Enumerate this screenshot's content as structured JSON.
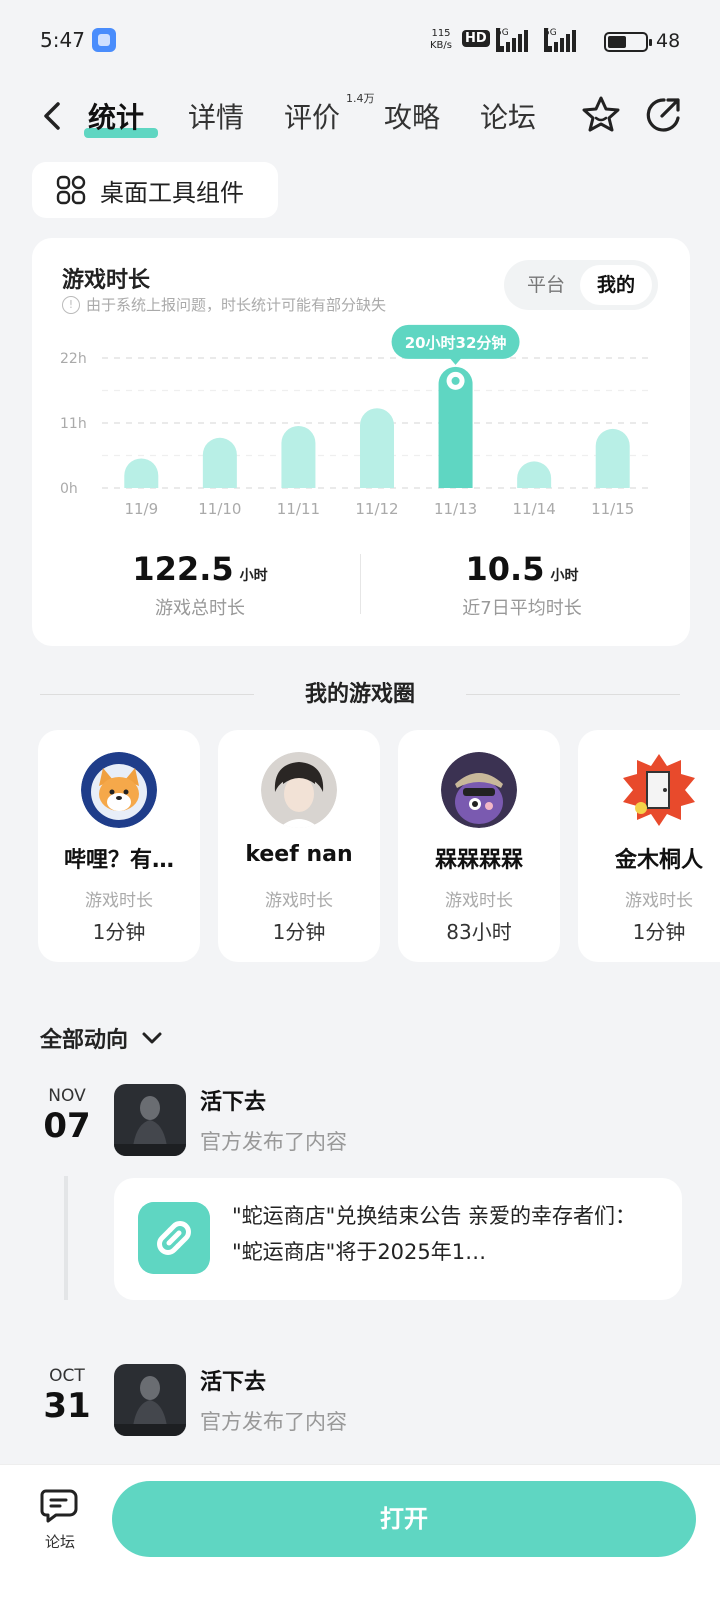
{
  "status_bar": {
    "time": "5:47",
    "net_speed": "115",
    "net_unit": "KB/s",
    "hd": "HD",
    "sim1": "5G",
    "sim2": "5G",
    "battery": "48"
  },
  "nav": {
    "tabs": [
      {
        "label": "统计",
        "active": true
      },
      {
        "label": "详情"
      },
      {
        "label": "评价",
        "badge": "1.4万"
      },
      {
        "label": "攻略"
      },
      {
        "label": "论坛"
      }
    ]
  },
  "widget_chip": {
    "label": "桌面工具组件"
  },
  "playtime_card": {
    "title": "游戏时长",
    "note": "由于系统上报问题，时长统计可能有部分缺失",
    "segment": {
      "options": [
        "平台",
        "我的"
      ],
      "selected": "我的"
    },
    "tooltip": "20小时32分钟",
    "total": {
      "value": "122.5",
      "unit": "小时",
      "caption": "游戏总时长"
    },
    "average": {
      "value": "10.5",
      "unit": "小时",
      "caption": "近7日平均时长"
    }
  },
  "chart_data": {
    "type": "bar",
    "categories": [
      "11/9",
      "11/10",
      "11/11",
      "11/12",
      "11/13",
      "11/14",
      "11/15"
    ],
    "values": [
      5,
      8.5,
      10.5,
      13.5,
      20.5,
      4.5,
      10
    ],
    "highlight_index": 4,
    "yticks": [
      "0h",
      "11h",
      "22h"
    ],
    "ylim": [
      0,
      22
    ],
    "colors": {
      "bar": "#b8efe6",
      "highlight": "#5fd6c2"
    }
  },
  "game_circle": {
    "title": "我的游戏圈",
    "friends": [
      {
        "name": "哔哩？有…",
        "label": "游戏时长",
        "value": "1分钟"
      },
      {
        "name": "keef nan",
        "label": "游戏时长",
        "value": "1分钟"
      },
      {
        "name": "槑槑槑槑",
        "label": "游戏时长",
        "value": "83小时"
      },
      {
        "name": "金木桐人",
        "label": "游戏时长",
        "value": "1分钟"
      }
    ]
  },
  "feed": {
    "filter": "全部动向",
    "posts": [
      {
        "month": "NOV",
        "day": "07",
        "game": "活下去",
        "action": "官方发布了内容",
        "link_text": "\"蛇运商店\"兑换结束公告 亲爱的幸存者们：  \"蛇运商店\"将于2025年1…"
      },
      {
        "month": "OCT",
        "day": "31",
        "game": "活下去",
        "action": "官方发布了内容"
      }
    ]
  },
  "bottom": {
    "forum_label": "论坛",
    "open_label": "打开"
  }
}
